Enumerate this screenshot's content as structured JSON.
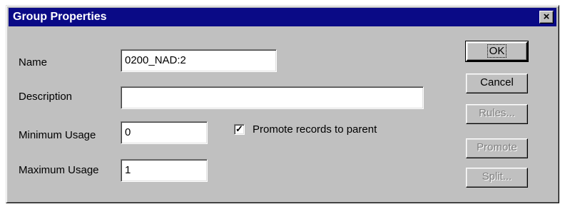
{
  "dialog": {
    "title": "Group Properties",
    "close_glyph": "✕"
  },
  "form": {
    "name_label": "Name",
    "name_value": "0200_NAD:2",
    "description_label": "Description",
    "description_value": "",
    "min_usage_label": "Minimum Usage",
    "min_usage_value": "0",
    "max_usage_label": "Maximum Usage",
    "max_usage_value": "1",
    "promote_label": "Promote records to parent",
    "promote_checked": true,
    "check_glyph": "✔"
  },
  "buttons": {
    "ok": "OK",
    "cancel": "Cancel",
    "rules": "Rules...",
    "promote": "Promote",
    "split": "Split..."
  }
}
